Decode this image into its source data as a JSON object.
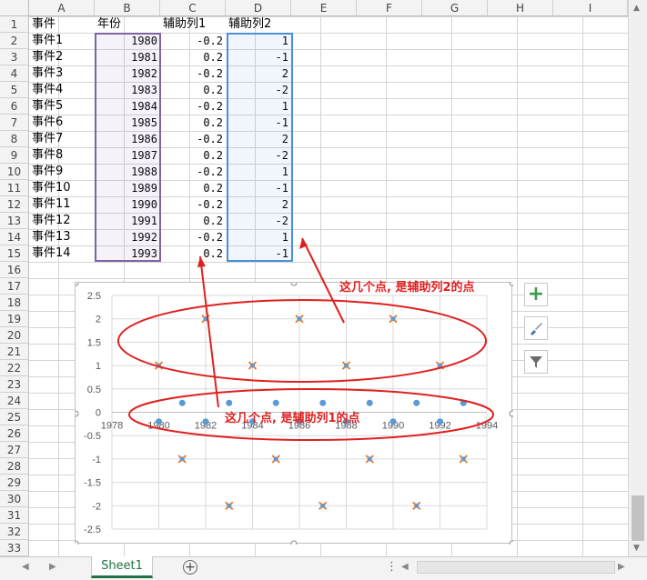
{
  "columns": [
    "A",
    "B",
    "C",
    "D",
    "E",
    "F",
    "G",
    "H",
    "I"
  ],
  "rows": [
    "1",
    "2",
    "3",
    "4",
    "5",
    "6",
    "7",
    "8",
    "9",
    "10",
    "11",
    "12",
    "13",
    "14",
    "15",
    "16",
    "17",
    "18",
    "19",
    "20",
    "21",
    "22",
    "23",
    "24",
    "25",
    "26",
    "27",
    "28",
    "29",
    "30",
    "31",
    "32",
    "33"
  ],
  "header_row": [
    "事件",
    "年份",
    "辅助列1",
    "辅助列2"
  ],
  "table": [
    {
      "event": "事件1",
      "year": "1980",
      "h1": "-0.2",
      "h2": "1"
    },
    {
      "event": "事件2",
      "year": "1981",
      "h1": "0.2",
      "h2": "-1"
    },
    {
      "event": "事件3",
      "year": "1982",
      "h1": "-0.2",
      "h2": "2"
    },
    {
      "event": "事件4",
      "year": "1983",
      "h1": "0.2",
      "h2": "-2"
    },
    {
      "event": "事件5",
      "year": "1984",
      "h1": "-0.2",
      "h2": "1"
    },
    {
      "event": "事件6",
      "year": "1985",
      "h1": "0.2",
      "h2": "-1"
    },
    {
      "event": "事件7",
      "year": "1986",
      "h1": "-0.2",
      "h2": "2"
    },
    {
      "event": "事件8",
      "year": "1987",
      "h1": "0.2",
      "h2": "-2"
    },
    {
      "event": "事件9",
      "year": "1988",
      "h1": "-0.2",
      "h2": "1"
    },
    {
      "event": "事件10",
      "year": "1989",
      "h1": "0.2",
      "h2": "-1"
    },
    {
      "event": "事件11",
      "year": "1990",
      "h1": "-0.2",
      "h2": "2"
    },
    {
      "event": "事件12",
      "year": "1991",
      "h1": "0.2",
      "h2": "-2"
    },
    {
      "event": "事件13",
      "year": "1992",
      "h1": "-0.2",
      "h2": "1"
    },
    {
      "event": "事件14",
      "year": "1993",
      "h1": "0.2",
      "h2": "-1"
    }
  ],
  "annotations": {
    "label_series2": "这几个点, 是辅助列2的点",
    "label_series1": "这几个点, 是辅助列1的点",
    "color": "#e02020"
  },
  "sheet_tab": "Sheet1",
  "colors": {
    "series1": "#5b9bd5",
    "series2": "#ed7d31",
    "sel_year": "#7e57c2",
    "sel_h2": "#4a90d9"
  },
  "chart_data": {
    "type": "scatter",
    "xlim": [
      1978,
      1994
    ],
    "ylim": [
      -2.5,
      2.5
    ],
    "x_ticks": [
      "1978",
      "1980",
      "1982",
      "1984",
      "1986",
      "1988",
      "1990",
      "1992",
      "1994"
    ],
    "y_ticks": [
      "2.5",
      "2",
      "1.5",
      "1",
      "0.5",
      "0",
      "-0.5",
      "-1",
      "-1.5",
      "-2",
      "-2.5"
    ],
    "grid": true,
    "series": [
      {
        "x": [
          1980,
          1981,
          1982,
          1983,
          1984,
          1985,
          1986,
          1987,
          1988,
          1989,
          1990,
          1991,
          1992,
          1993
        ],
        "values": [
          -0.2,
          0.2,
          -0.2,
          0.2,
          -0.2,
          0.2,
          -0.2,
          0.2,
          -0.2,
          0.2,
          -0.2,
          0.2,
          -0.2,
          0.2
        ]
      },
      {
        "x": [
          1980,
          1981,
          1982,
          1983,
          1984,
          1985,
          1986,
          1987,
          1988,
          1989,
          1990,
          1991,
          1992,
          1993
        ],
        "values": [
          1,
          -1,
          2,
          -2,
          1,
          -1,
          2,
          -2,
          1,
          -1,
          2,
          -2,
          1,
          -1
        ]
      }
    ]
  }
}
